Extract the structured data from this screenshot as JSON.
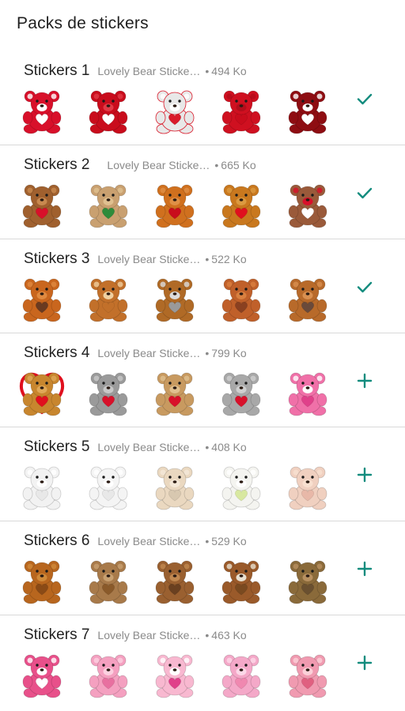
{
  "header": {
    "title": "Packs de stickers"
  },
  "colors": {
    "accent": "#128c7e",
    "divider": "#d9d9d9",
    "secondary_text": "#8a8a8a"
  },
  "packs": [
    {
      "name": "Stickers 1",
      "author": "Lovely Bear Sticke…",
      "dot": "•",
      "size": "494 Ko",
      "status": "added",
      "stickers": [
        {
          "fur": "#d8102a",
          "belly": "#ffffff",
          "heart": "#ffffff"
        },
        {
          "fur": "#c90c1c",
          "belly": "#e23a46",
          "heart": "#ffffff"
        },
        {
          "fur": "#e8e8e8",
          "belly": "#ffffff",
          "heart": "#d91a2a",
          "outline": "#d91a2a"
        },
        {
          "fur": "#cf1020",
          "belly": "#b30d1b",
          "heart": "#c90c1c"
        },
        {
          "fur": "#8e0d12",
          "belly": "#ffffff",
          "heart": "#ffffff"
        }
      ]
    },
    {
      "name": "Stickers 2",
      "author": "Lovely Bear Sticke…",
      "dot": "•",
      "size": "665 Ko",
      "status": "added",
      "stickers": [
        {
          "fur": "#a0602e",
          "belly": "#c9894f",
          "heart": "#d8102a"
        },
        {
          "fur": "#c9a070",
          "belly": "#e0c090",
          "heart": "#2e8b3a"
        },
        {
          "fur": "#d0701e",
          "belly": "#e09046",
          "heart": "#c90c1c"
        },
        {
          "fur": "#c9781e",
          "belly": "#dc9a40",
          "heart": "#e0101e"
        },
        {
          "fur": "#9a5a3a",
          "belly": "#d8102a",
          "heart": "#ffffff"
        }
      ]
    },
    {
      "name": "Stickers 3",
      "author": "Lovely Bear Sticke…",
      "dot": "•",
      "size": "522 Ko",
      "status": "added",
      "stickers": [
        {
          "fur": "#c9661e",
          "belly": "#e08a40",
          "heart": "#6a3a20"
        },
        {
          "fur": "#c2702a",
          "belly": "#f0d0a0",
          "heart": "#c2702a"
        },
        {
          "fur": "#b06a26",
          "belly": "#dcdcdc",
          "heart": "#9a9a9a"
        },
        {
          "fur": "#c0602a",
          "belly": "#d98040",
          "heart": "#8a4020"
        },
        {
          "fur": "#b86a2a",
          "belly": "#d99050",
          "heart": "#6a4a3a"
        }
      ]
    },
    {
      "name": "Stickers 4",
      "author": "Lovely Bear Sticke…",
      "dot": "•",
      "size": "799 Ko",
      "status": "add",
      "stickers": [
        {
          "fur": "#c8862e",
          "belly": "#e0a858",
          "heart": "#e0101e",
          "frame": "#e0101e"
        },
        {
          "fur": "#9a9a9a",
          "belly": "#c8c8c8",
          "heart": "#d8102a"
        },
        {
          "fur": "#c89a60",
          "belly": "#e0c090",
          "heart": "#d8102a"
        },
        {
          "fur": "#a8a8a8",
          "belly": "#d0d0d0",
          "heart": "#d8102a"
        },
        {
          "fur": "#f070a8",
          "belly": "#ffffff",
          "heart": "#e0408a"
        }
      ]
    },
    {
      "name": "Stickers 5",
      "author": "Lovely Bear Sticke…",
      "dot": "•",
      "size": "408 Ko",
      "status": "add",
      "stickers": [
        {
          "fur": "#f2f2f2",
          "belly": "#ffffff",
          "heart": "#e8e8e8"
        },
        {
          "fur": "#f4f4f4",
          "belly": "#ffffff",
          "heart": "#e8e8e8"
        },
        {
          "fur": "#ead8c0",
          "belly": "#f4e8d8",
          "heart": "#d8c8b0"
        },
        {
          "fur": "#f4f4f0",
          "belly": "#ffffff",
          "heart": "#d8e8a0"
        },
        {
          "fur": "#f0d0c0",
          "belly": "#f8e0d0",
          "heart": "#e8b8a8"
        }
      ]
    },
    {
      "name": "Stickers 6",
      "author": "Lovely Bear Sticke…",
      "dot": "•",
      "size": "529 Ko",
      "status": "add",
      "stickers": [
        {
          "fur": "#b8661e",
          "belly": "#d08a3a",
          "heart": "#8a4a16"
        },
        {
          "fur": "#a87a4a",
          "belly": "#c8a070",
          "heart": "#8a5a2a"
        },
        {
          "fur": "#9a6030",
          "belly": "#c08850",
          "heart": "#6a4020"
        },
        {
          "fur": "#9a5a2a",
          "belly": "#e8e0d0",
          "heart": "#7a4a20"
        },
        {
          "fur": "#8a6a3a",
          "belly": "#b89060",
          "heart": "#6a5030"
        }
      ]
    },
    {
      "name": "Stickers 7",
      "author": "Lovely Bear Sticke…",
      "dot": "•",
      "size": "463 Ko",
      "status": "add",
      "stickers": [
        {
          "fur": "#e8508a",
          "belly": "#ffffff",
          "heart": "#ffffff"
        },
        {
          "fur": "#f4a0c0",
          "belly": "#fcd0e0",
          "heart": "#e870a0"
        },
        {
          "fur": "#f8b8d0",
          "belly": "#ffffff",
          "heart": "#e0408a"
        },
        {
          "fur": "#f4a8c8",
          "belly": "#fcd8e8",
          "heart": "#f088b0"
        },
        {
          "fur": "#f09ab0",
          "belly": "#fbd0d8",
          "heart": "#e06080"
        }
      ]
    }
  ]
}
